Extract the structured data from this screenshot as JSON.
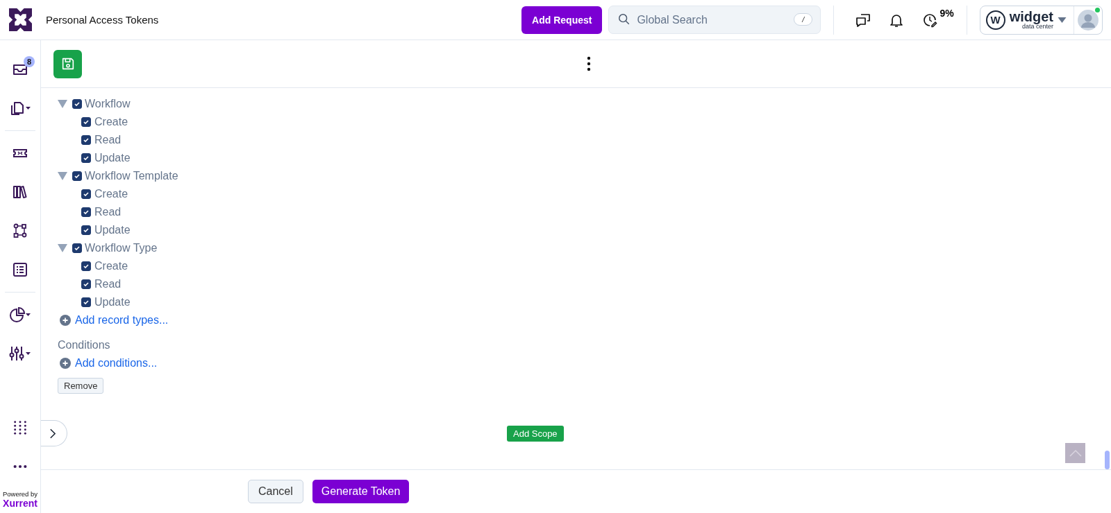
{
  "header": {
    "title": "Personal Access Tokens",
    "add_request": "Add Request",
    "search": {
      "placeholder": "Global Search",
      "shortcut": "/"
    },
    "progress": "9%",
    "account": {
      "logo_mark": "W",
      "name": "widget",
      "subtitle": "data center",
      "online": true
    }
  },
  "sidebar": {
    "inbox_badge": "8",
    "powered_by": "Powered by",
    "brand": "Xurrent"
  },
  "scope": {
    "record_types": [
      {
        "label": "Workflow",
        "expanded": true,
        "checked": true,
        "children": [
          {
            "label": "Create",
            "checked": true
          },
          {
            "label": "Read",
            "checked": true
          },
          {
            "label": "Update",
            "checked": true
          }
        ]
      },
      {
        "label": "Workflow Template",
        "expanded": true,
        "checked": true,
        "children": [
          {
            "label": "Create",
            "checked": true
          },
          {
            "label": "Read",
            "checked": true
          },
          {
            "label": "Update",
            "checked": true
          }
        ]
      },
      {
        "label": "Workflow Type",
        "expanded": true,
        "checked": true,
        "children": [
          {
            "label": "Create",
            "checked": true
          },
          {
            "label": "Read",
            "checked": true
          },
          {
            "label": "Update",
            "checked": true
          }
        ]
      }
    ],
    "add_record_types": "Add record types...",
    "conditions_label": "Conditions",
    "add_conditions": "Add conditions...",
    "remove": "Remove"
  },
  "add_scope": "Add Scope",
  "footer": {
    "cancel": "Cancel",
    "generate": "Generate Token"
  }
}
